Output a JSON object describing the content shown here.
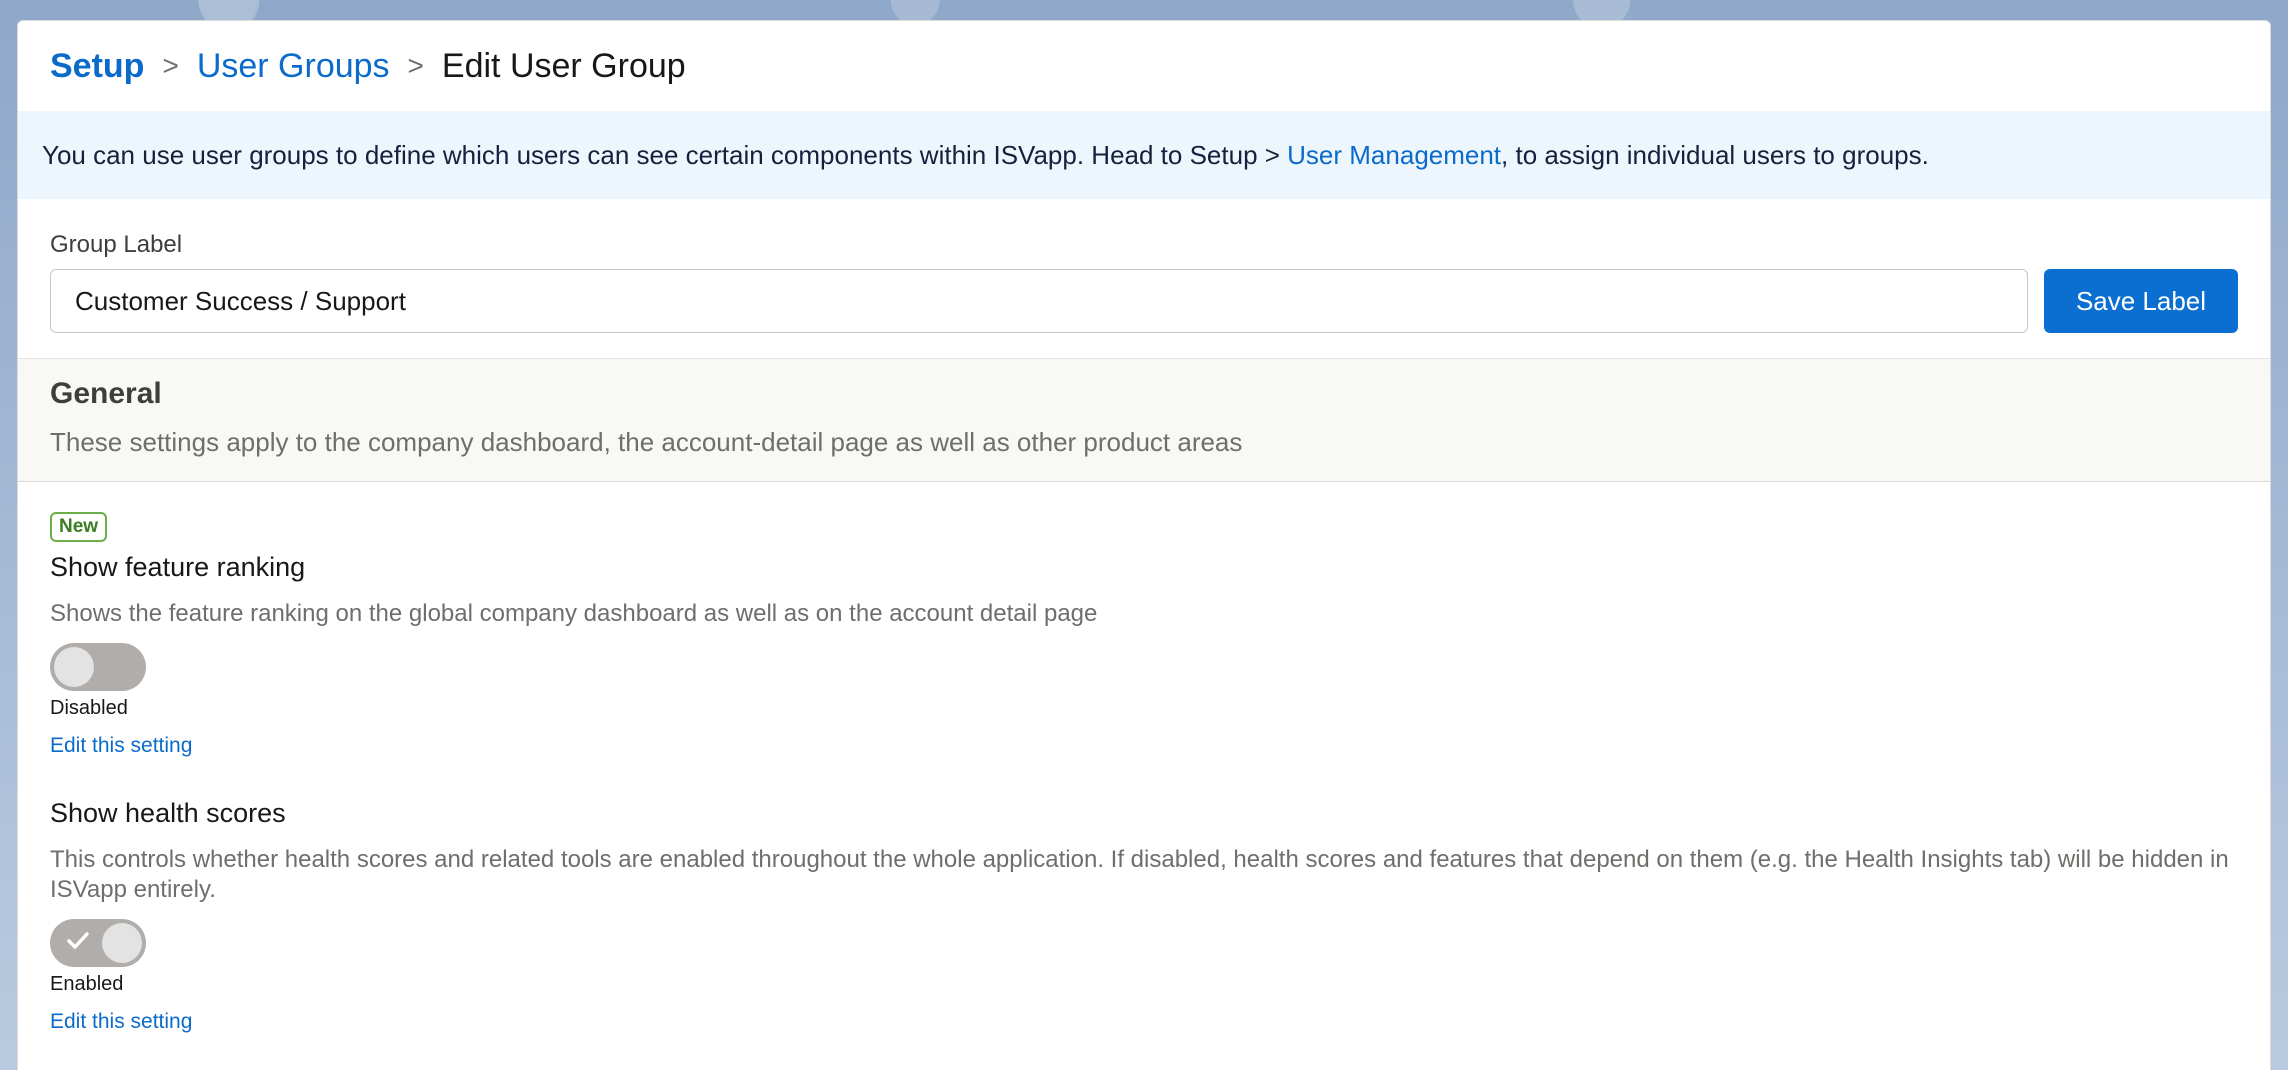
{
  "breadcrumb": {
    "root": "Setup",
    "parent": "User Groups",
    "current": "Edit User Group",
    "separator": ">"
  },
  "info_banner": {
    "text_before": "You can use user groups to define which users can see certain components within ISVapp. Head to Setup > ",
    "link_text": "User Management",
    "text_after": ", to assign individual users to groups."
  },
  "group_label": {
    "label": "Group Label",
    "value": "Customer Success / Support",
    "save_label": "Save Label"
  },
  "general": {
    "title": "General",
    "description": "These settings apply to the company dashboard, the account-detail page as well as other product areas"
  },
  "settings": [
    {
      "badge": "New",
      "title": "Show feature ranking",
      "description": "Shows the feature ranking on the global company dashboard as well as on the account detail page",
      "enabled": false,
      "status": "Disabled",
      "edit_link": "Edit this setting"
    },
    {
      "title": "Show health scores",
      "description": "This controls whether health scores and related tools are enabled throughout the whole application. If disabled, health scores and features that depend on them (e.g. the Health Insights tab) will be hidden in ISVapp entirely.",
      "enabled": true,
      "status": "Enabled",
      "edit_link": "Edit this setting"
    }
  ],
  "colors": {
    "brand_blue": "#0a6fd1",
    "link_blue": "#0b6bcb",
    "badge_green": "#6cae4a",
    "toggle_gray": "#b0adab"
  }
}
